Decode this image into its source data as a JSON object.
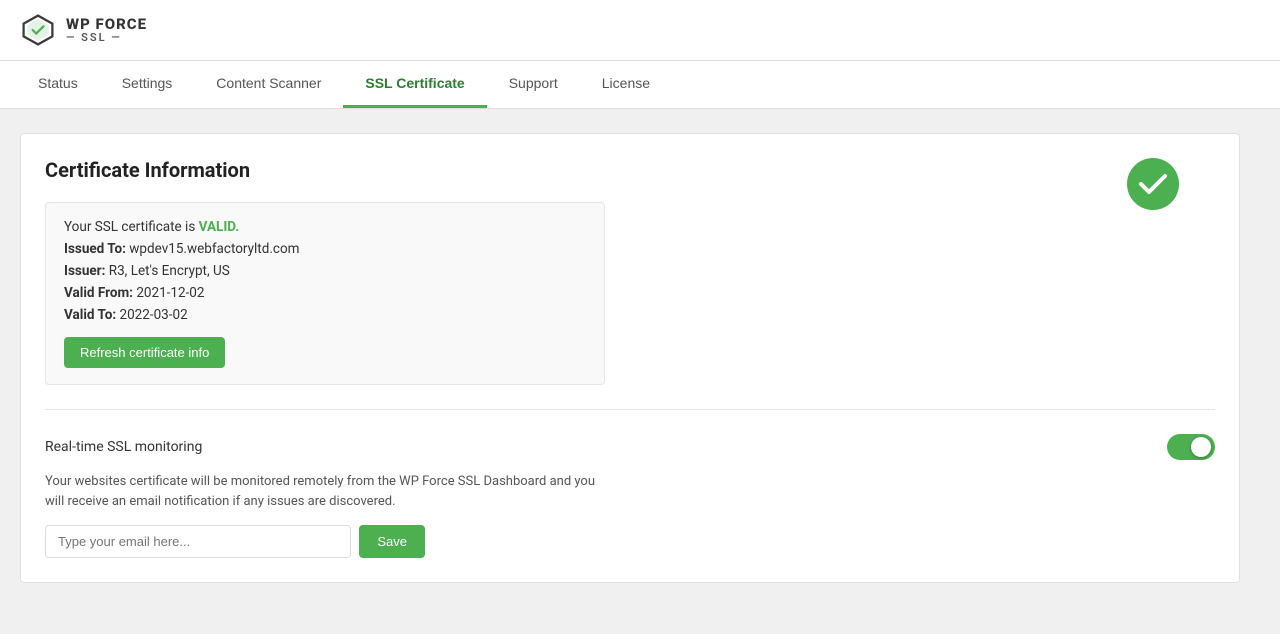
{
  "header": {
    "logo_wp": "WP FORCE",
    "logo_ssl": "— SSL —"
  },
  "tabs": [
    {
      "id": "status",
      "label": "Status",
      "active": false
    },
    {
      "id": "settings",
      "label": "Settings",
      "active": false
    },
    {
      "id": "content-scanner",
      "label": "Content Scanner",
      "active": false
    },
    {
      "id": "ssl-certificate",
      "label": "SSL Certificate",
      "active": true
    },
    {
      "id": "support",
      "label": "Support",
      "active": false
    },
    {
      "id": "license",
      "label": "License",
      "active": false
    }
  ],
  "certificate_section": {
    "title": "Certificate Information",
    "status_text": "Your SSL certificate is ",
    "status_valid": "VALID.",
    "issued_to_label": "Issued To:",
    "issued_to_value": "wpdev15.webfactoryltd.com",
    "issuer_label": "Issuer:",
    "issuer_value": "R3, Let's Encrypt, US",
    "valid_from_label": "Valid From:",
    "valid_from_value": "2021-12-02",
    "valid_to_label": "Valid To:",
    "valid_to_value": "2022-03-02",
    "refresh_button": "Refresh certificate info"
  },
  "monitoring_section": {
    "label": "Real-time SSL monitoring",
    "toggle_on": true,
    "description": "Your websites certificate will be monitored remotely from the WP Force SSL Dashboard and you will receive an email notification if any issues are discovered.",
    "email_placeholder": "Type your email here...",
    "save_button": "Save"
  }
}
